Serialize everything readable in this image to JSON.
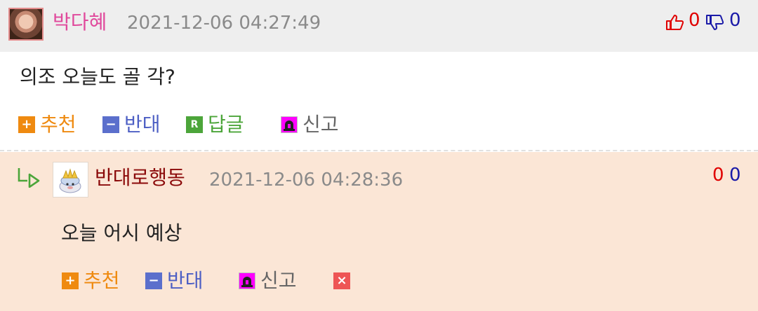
{
  "comment": {
    "author": "박다혜",
    "timestamp": "2021-12-06 04:27:49",
    "upvotes": "0",
    "downvotes": "0",
    "body": "의조 오늘도 골 각?",
    "actions": {
      "recommend": "추천",
      "oppose": "반대",
      "reply": "답글",
      "report": "신고"
    },
    "icons": {
      "recommend": "+",
      "oppose": "−",
      "reply": "R"
    }
  },
  "reply": {
    "author": "반대로행동",
    "timestamp": "2021-12-06 04:28:36",
    "upvotes": "0",
    "downvotes": "0",
    "body": "오늘 어시 예상",
    "actions": {
      "recommend": "추천",
      "oppose": "반대",
      "report": "신고"
    },
    "icons": {
      "recommend": "+",
      "oppose": "−",
      "delete": "×"
    }
  },
  "colors": {
    "author_main": "#e0499c",
    "author_reply": "#8b0a0a",
    "upvote": "#e00000",
    "downvote": "#1a1aa8",
    "recommend": "#ef8a10",
    "oppose": "#4d5fc4",
    "reply_action": "#4ca53a",
    "report_icon": "#ff00ff",
    "reply_background": "#fbe6d6"
  }
}
